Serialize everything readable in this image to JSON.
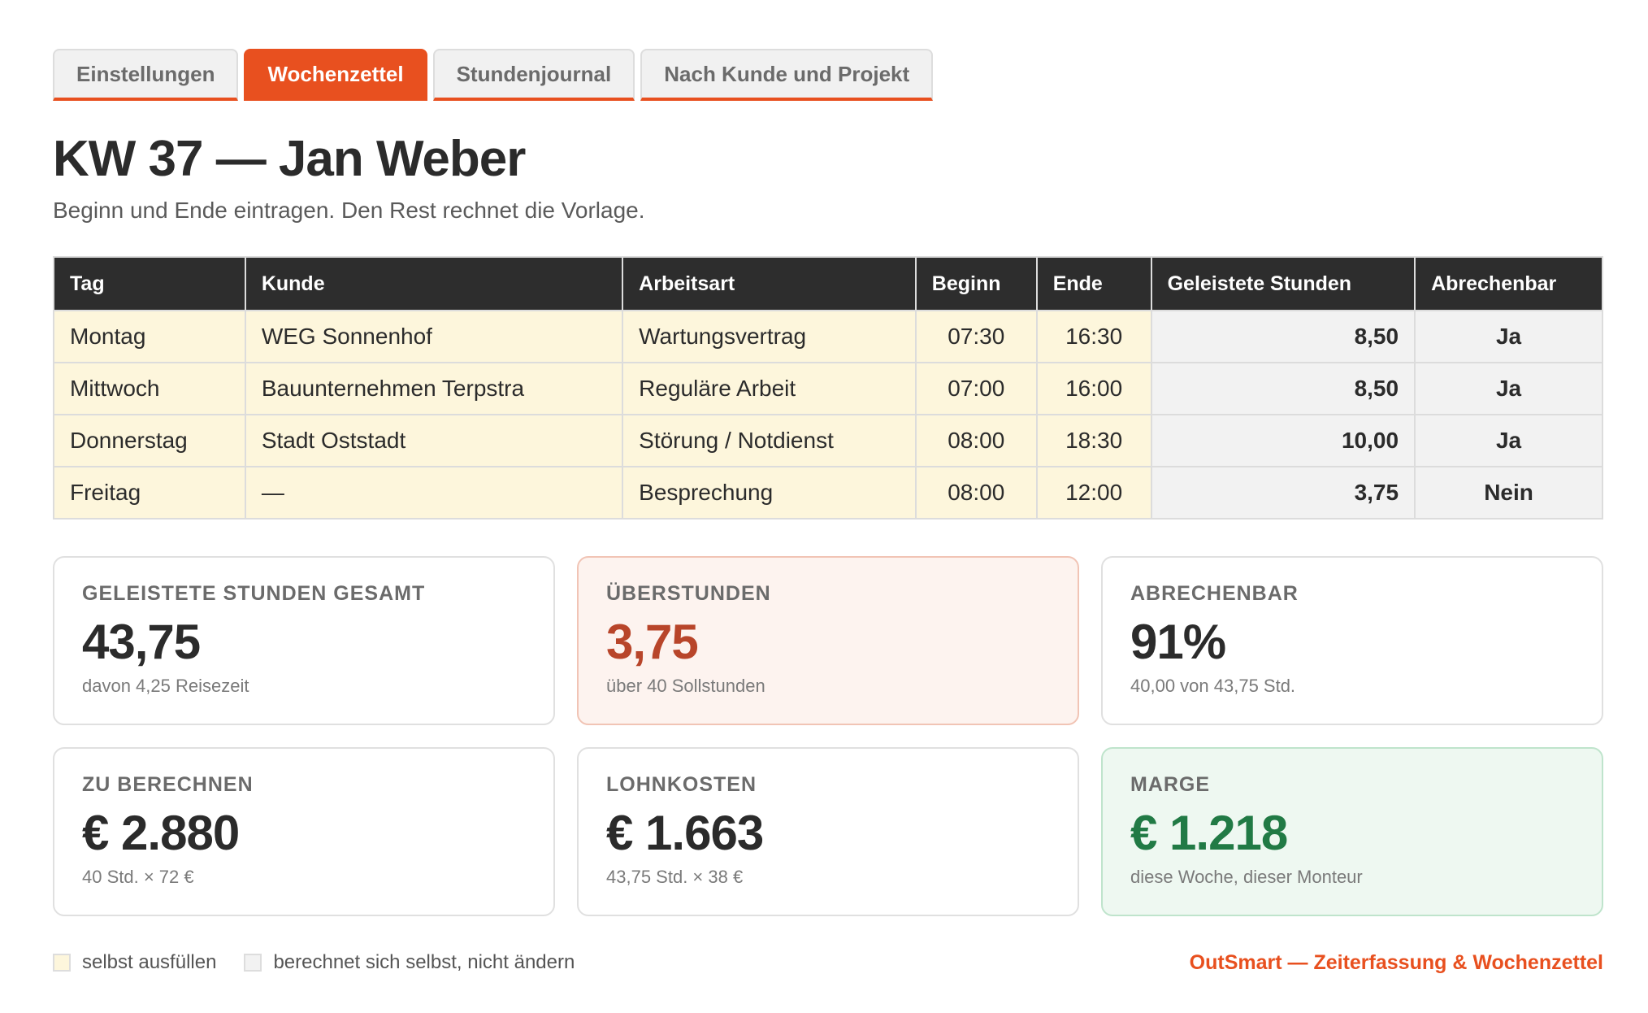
{
  "tabs": [
    {
      "label": "Einstellungen",
      "active": false
    },
    {
      "label": "Wochenzettel",
      "active": true
    },
    {
      "label": "Stundenjournal",
      "active": false
    },
    {
      "label": "Nach Kunde und Projekt",
      "active": false
    }
  ],
  "header": {
    "title": "KW 37 — Jan Weber",
    "subtitle": "Beginn und Ende eintragen. Den Rest rechnet die Vorlage."
  },
  "table": {
    "columns": [
      "Tag",
      "Kunde",
      "Arbeitsart",
      "Beginn",
      "Ende",
      "Geleistete Stunden",
      "Abrechenbar"
    ],
    "rows": [
      {
        "tag": "Montag",
        "kunde": "WEG Sonnenhof",
        "arbeitsart": "Wartungsvertrag",
        "beginn": "07:30",
        "ende": "16:30",
        "stunden": "8,50",
        "abrechenbar": "Ja"
      },
      {
        "tag": "Mittwoch",
        "kunde": "Bauunternehmen Terpstra",
        "arbeitsart": "Reguläre Arbeit",
        "beginn": "07:00",
        "ende": "16:00",
        "stunden": "8,50",
        "abrechenbar": "Ja"
      },
      {
        "tag": "Donnerstag",
        "kunde": "Stadt Oststadt",
        "arbeitsart": "Störung / Notdienst",
        "beginn": "08:00",
        "ende": "18:30",
        "stunden": "10,00",
        "abrechenbar": "Ja"
      },
      {
        "tag": "Freitag",
        "kunde": "—",
        "arbeitsart": "Besprechung",
        "beginn": "08:00",
        "ende": "12:00",
        "stunden": "3,75",
        "abrechenbar": "Nein"
      }
    ]
  },
  "cards": [
    {
      "label": "GELEISTETE STUNDEN GESAMT",
      "value": "43,75",
      "note": "davon 4,25 Reisezeit"
    },
    {
      "label": "ÜBERSTUNDEN",
      "value": "3,75",
      "note": "über 40 Sollstunden"
    },
    {
      "label": "ABRECHENBAR",
      "value": "91%",
      "note": "40,00 von 43,75 Std."
    },
    {
      "label": "ZU BERECHNEN",
      "value": "€ 2.880",
      "note": "40 Std. × 72 €"
    },
    {
      "label": "LOHNKOSTEN",
      "value": "€ 1.663",
      "note": "43,75 Std. × 38 €"
    },
    {
      "label": "MARGE",
      "value": "€ 1.218",
      "note": "diese Woche, dieser Monteur"
    }
  ],
  "legend": {
    "fill_label": "selbst ausfüllen",
    "calc_label": "berechnet sich selbst, nicht ändern"
  },
  "brand": "OutSmart — Zeiterfassung & Wochenzettel",
  "colors": {
    "accent": "#e8501f",
    "fill_cell": "#fdf6dc",
    "calc_cell": "#f2f2f2",
    "yes": "#2e8b4f",
    "no": "#b23a2a"
  }
}
